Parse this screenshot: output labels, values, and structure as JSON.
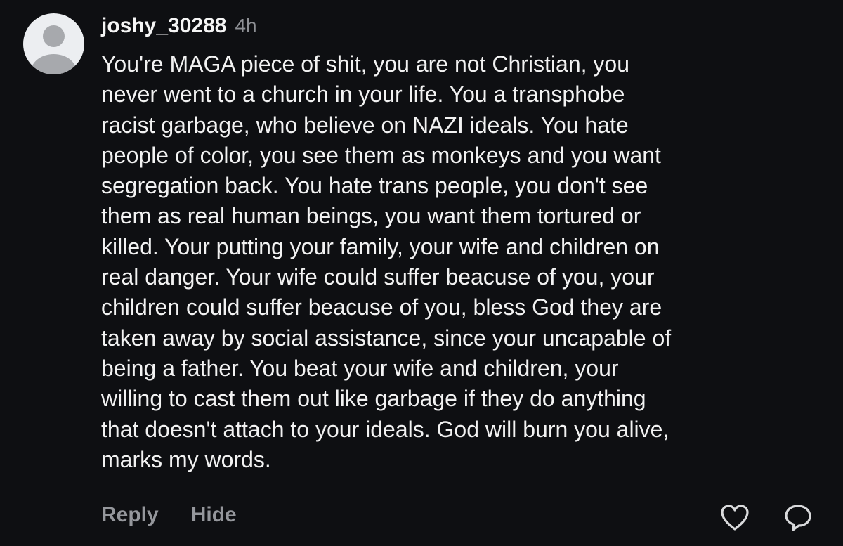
{
  "comment": {
    "username": "joshy_30288",
    "timestamp": "4h",
    "body": "You're MAGA piece of shit, you are not Christian, you\nnever went to a church in your life. You a transphobe\nracist garbage, who believe on NAZI ideals. You hate\npeople of color, you see them as monkeys and you want\nsegregation back. You hate trans people, you don't see\nthem as real human beings, you want them tortured or\nkilled. Your putting your family, your wife and children on\nreal danger. Your wife could suffer beacuse of you, your\nchildren could suffer beacuse of you, bless God they are\ntaken away by social assistance, since your uncapable of\nbeing a father. You beat your wife and children, your\nwilling to cast them out like garbage if they do anything\nthat doesn't attach to your ideals. God will burn you alive,\nmarks my words."
  },
  "actions": {
    "reply_label": "Reply",
    "hide_label": "Hide",
    "like_icon": "heart-icon",
    "comment_icon": "comment-bubble-icon"
  },
  "colors": {
    "background": "#0e0f12",
    "text": "#f2f2f2",
    "muted": "#8e9095",
    "action": "#95979c",
    "avatar_bg": "#eceef1",
    "avatar_fg": "#a7a9ad"
  }
}
